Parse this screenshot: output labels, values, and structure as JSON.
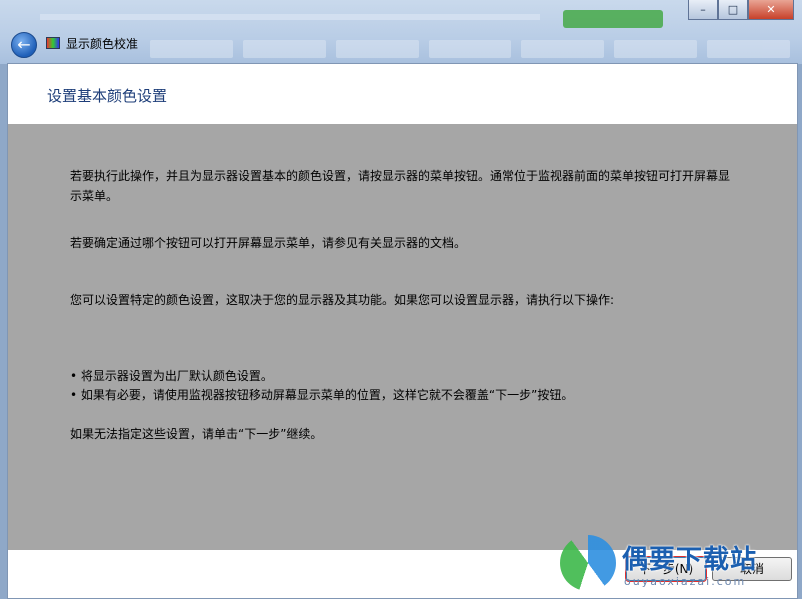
{
  "window": {
    "title": "显示颜色校准",
    "controls": {
      "minimize": "–",
      "maximize": "□",
      "close": "✕"
    }
  },
  "page": {
    "heading": "设置基本颜色设置",
    "paragraphs": [
      "若要执行此操作，并且为显示器设置基本的颜色设置，请按显示器的菜单按钮。通常位于监视器前面的菜单按钮可打开屏幕显示菜单。",
      "若要确定通过哪个按钮可以打开屏幕显示菜单，请参见有关显示器的文档。",
      "您可以设置特定的颜色设置，这取决于您的显示器及其功能。如果您可以设置显示器，请执行以下操作:"
    ],
    "bullets": [
      "• 将显示器设置为出厂默认颜色设置。",
      "• 如果有必要，请使用监视器按钮移动屏幕显示菜单的位置，这样它就不会覆盖“下一步”按钮。"
    ],
    "closing": "如果无法指定这些设置，请单击“下一步”继续。"
  },
  "footer": {
    "next_label": "下一步(N)",
    "cancel_label": "取消"
  },
  "watermark": {
    "brand": "偶要下载站",
    "domain": "ouyaoxiazai.com"
  },
  "colors": {
    "heading": "#1e3e79",
    "content_bg": "#a6a6a6",
    "panel_bg": "#ffffff"
  }
}
